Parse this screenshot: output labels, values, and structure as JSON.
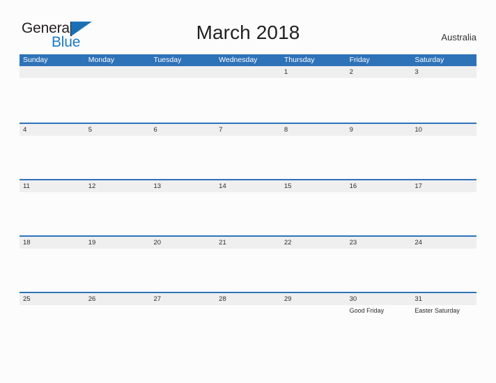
{
  "brand": {
    "name_part1": "General",
    "name_part2": "Blue",
    "triangle_color": "#1a6fb5",
    "text_color": "#231f20",
    "blue_color": "#1a7bc4"
  },
  "header": {
    "title": "March 2018",
    "region": "Australia"
  },
  "theme": {
    "header_blue": "#2e72b8",
    "divider_blue": "#2e72b8",
    "date_band": "#efeff0",
    "page_background": "#fcfcfd",
    "text": "#2b2b2b"
  },
  "calendar": {
    "month": "March",
    "year": "2018",
    "day_headers": [
      "Sunday",
      "Monday",
      "Tuesday",
      "Wednesday",
      "Thursday",
      "Friday",
      "Saturday"
    ],
    "weeks": [
      {
        "days": [
          {
            "date": "",
            "event": ""
          },
          {
            "date": "",
            "event": ""
          },
          {
            "date": "",
            "event": ""
          },
          {
            "date": "",
            "event": ""
          },
          {
            "date": "1",
            "event": ""
          },
          {
            "date": "2",
            "event": ""
          },
          {
            "date": "3",
            "event": ""
          }
        ]
      },
      {
        "days": [
          {
            "date": "4",
            "event": ""
          },
          {
            "date": "5",
            "event": ""
          },
          {
            "date": "6",
            "event": ""
          },
          {
            "date": "7",
            "event": ""
          },
          {
            "date": "8",
            "event": ""
          },
          {
            "date": "9",
            "event": ""
          },
          {
            "date": "10",
            "event": ""
          }
        ]
      },
      {
        "days": [
          {
            "date": "11",
            "event": ""
          },
          {
            "date": "12",
            "event": ""
          },
          {
            "date": "13",
            "event": ""
          },
          {
            "date": "14",
            "event": ""
          },
          {
            "date": "15",
            "event": ""
          },
          {
            "date": "16",
            "event": ""
          },
          {
            "date": "17",
            "event": ""
          }
        ]
      },
      {
        "days": [
          {
            "date": "18",
            "event": ""
          },
          {
            "date": "19",
            "event": ""
          },
          {
            "date": "20",
            "event": ""
          },
          {
            "date": "21",
            "event": ""
          },
          {
            "date": "22",
            "event": ""
          },
          {
            "date": "23",
            "event": ""
          },
          {
            "date": "24",
            "event": ""
          }
        ]
      },
      {
        "days": [
          {
            "date": "25",
            "event": ""
          },
          {
            "date": "26",
            "event": ""
          },
          {
            "date": "27",
            "event": ""
          },
          {
            "date": "28",
            "event": ""
          },
          {
            "date": "29",
            "event": ""
          },
          {
            "date": "30",
            "event": "Good Friday"
          },
          {
            "date": "31",
            "event": "Easter Saturday"
          }
        ]
      }
    ]
  }
}
